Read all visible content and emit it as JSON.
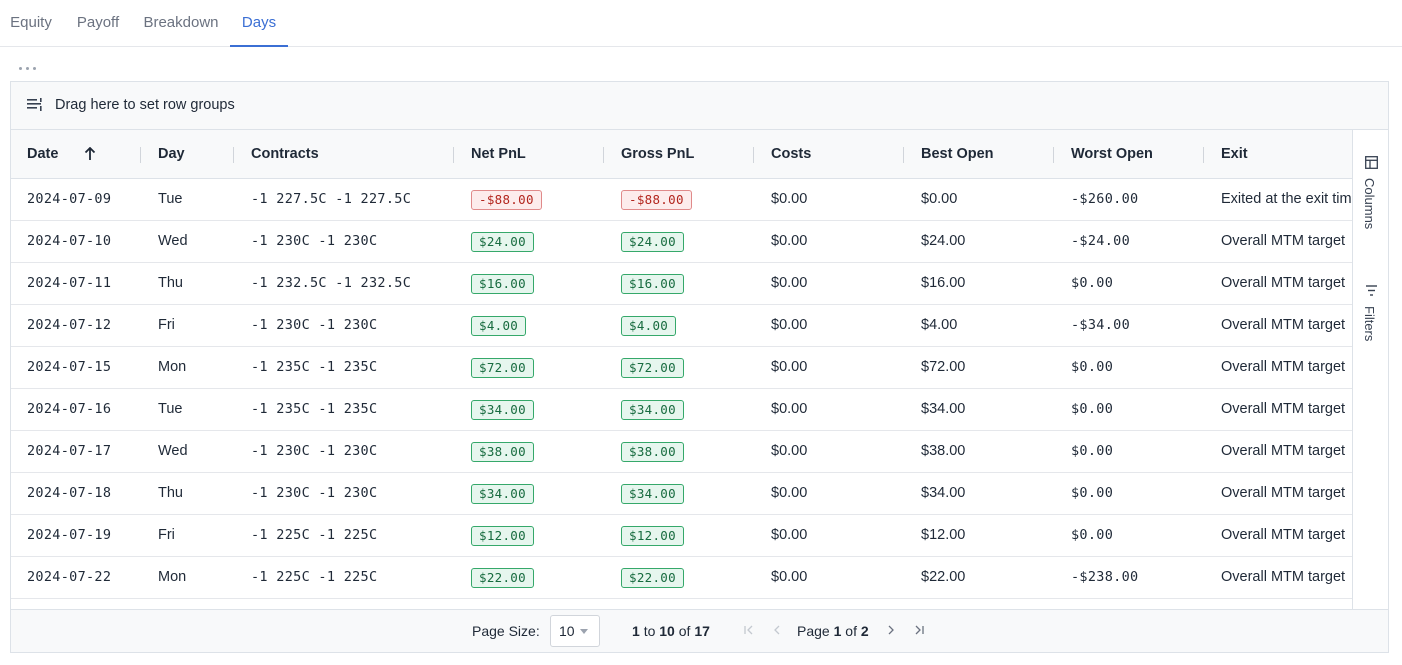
{
  "tabs": [
    {
      "label": "Equity"
    },
    {
      "label": "Payoff"
    },
    {
      "label": "Breakdown"
    },
    {
      "label": "Days"
    }
  ],
  "active_tab": "Days",
  "grid": {
    "group_bar_text": "Drag here to set row groups",
    "columns": [
      "Date",
      "Day",
      "Contracts",
      "Net PnL",
      "Gross PnL",
      "Costs",
      "Best Open",
      "Worst Open",
      "Exit"
    ],
    "sort_column": "Date",
    "sort_direction": "ascending",
    "rows": [
      {
        "date": "2024-07-09",
        "day": "Tue",
        "contracts": "-1 227.5C -1 227.5C",
        "net": "-$88.00",
        "gross": "-$88.00",
        "costs": "$0.00",
        "best": "$0.00",
        "worst": "-$260.00",
        "exit": "Exited at the exit time",
        "status": "neg"
      },
      {
        "date": "2024-07-10",
        "day": "Wed",
        "contracts": "-1 230C -1 230C",
        "net": "$24.00",
        "gross": "$24.00",
        "costs": "$0.00",
        "best": "$24.00",
        "worst": "-$24.00",
        "exit": "Overall MTM target",
        "status": "pos"
      },
      {
        "date": "2024-07-11",
        "day": "Thu",
        "contracts": "-1 232.5C -1 232.5C",
        "net": "$16.00",
        "gross": "$16.00",
        "costs": "$0.00",
        "best": "$16.00",
        "worst": "$0.00",
        "exit": "Overall MTM target",
        "status": "pos"
      },
      {
        "date": "2024-07-12",
        "day": "Fri",
        "contracts": "-1 230C -1 230C",
        "net": "$4.00",
        "gross": "$4.00",
        "costs": "$0.00",
        "best": "$4.00",
        "worst": "-$34.00",
        "exit": "Overall MTM target",
        "status": "pos"
      },
      {
        "date": "2024-07-15",
        "day": "Mon",
        "contracts": "-1 235C -1 235C",
        "net": "$72.00",
        "gross": "$72.00",
        "costs": "$0.00",
        "best": "$72.00",
        "worst": "$0.00",
        "exit": "Overall MTM target",
        "status": "pos"
      },
      {
        "date": "2024-07-16",
        "day": "Tue",
        "contracts": "-1 235C -1 235C",
        "net": "$34.00",
        "gross": "$34.00",
        "costs": "$0.00",
        "best": "$34.00",
        "worst": "$0.00",
        "exit": "Overall MTM target",
        "status": "pos"
      },
      {
        "date": "2024-07-17",
        "day": "Wed",
        "contracts": "-1 230C -1 230C",
        "net": "$38.00",
        "gross": "$38.00",
        "costs": "$0.00",
        "best": "$38.00",
        "worst": "$0.00",
        "exit": "Overall MTM target",
        "status": "pos"
      },
      {
        "date": "2024-07-18",
        "day": "Thu",
        "contracts": "-1 230C -1 230C",
        "net": "$34.00",
        "gross": "$34.00",
        "costs": "$0.00",
        "best": "$34.00",
        "worst": "$0.00",
        "exit": "Overall MTM target",
        "status": "pos"
      },
      {
        "date": "2024-07-19",
        "day": "Fri",
        "contracts": "-1 225C -1 225C",
        "net": "$12.00",
        "gross": "$12.00",
        "costs": "$0.00",
        "best": "$12.00",
        "worst": "$0.00",
        "exit": "Overall MTM target",
        "status": "pos"
      },
      {
        "date": "2024-07-22",
        "day": "Mon",
        "contracts": "-1 225C -1 225C",
        "net": "$22.00",
        "gross": "$22.00",
        "costs": "$0.00",
        "best": "$22.00",
        "worst": "-$238.00",
        "exit": "Overall MTM target",
        "status": "pos"
      }
    ]
  },
  "side_panel": {
    "columns_label": "Columns",
    "filters_label": "Filters"
  },
  "pagination": {
    "page_size_label": "Page Size:",
    "page_size": "10",
    "from": "1",
    "to_word": "to",
    "to": "10",
    "of_word": "of",
    "total": "17",
    "page_word": "Page",
    "page": "1",
    "page_of_word": "of",
    "page_count": "2"
  },
  "colors": {
    "accent": "#3b6fd4",
    "positive_bg": "#e6f6ee",
    "positive_border": "#35a86a",
    "negative_bg": "#fdecec",
    "negative_border": "#e08a8a"
  },
  "icons": {
    "more": "more-dots-icon",
    "group": "row-group-icon",
    "sort": "sort-ascending-icon",
    "columns": "columns-icon",
    "filters": "filter-icon",
    "first": "first-page-icon",
    "prev": "previous-page-icon",
    "next": "next-page-icon",
    "last": "last-page-icon"
  }
}
